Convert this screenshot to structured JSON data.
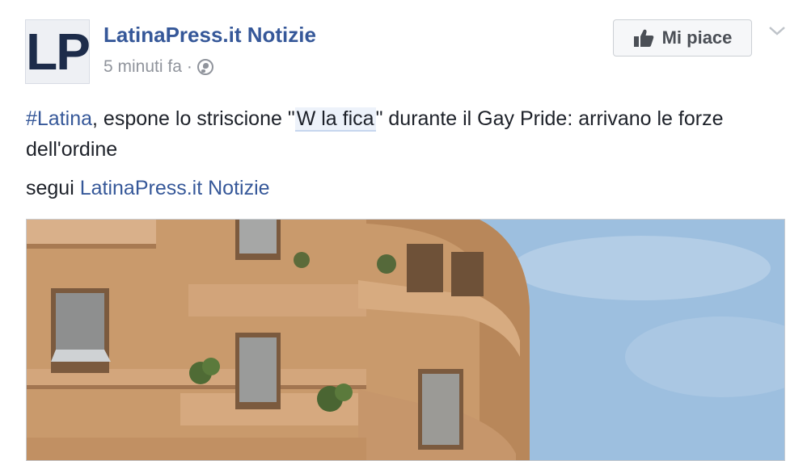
{
  "post": {
    "page_name": "LatinaPress.it Notizie",
    "avatar_text": "LP",
    "timestamp": "5 minuti fa",
    "separator": "·",
    "privacy_icon": "globe-icon",
    "like_button_label": "Mi piace",
    "like_icon": "thumbs-up-icon",
    "menu_icon": "chevron-down-icon",
    "text": {
      "hashtag": "#Latina",
      "part1": ", espone lo striscione \"",
      "highlight": "W la fica",
      "part2": "\" durante il Gay Pride: arrivano le forze dell'ordine"
    },
    "follow": {
      "prefix": "segui ",
      "link": "LatinaPress.it Notizie"
    },
    "image_description_icon": "photo-building"
  },
  "colors": {
    "link": "#365899",
    "text": "#1d2129",
    "meta": "#90949c",
    "button_bg": "#f6f7f9"
  }
}
